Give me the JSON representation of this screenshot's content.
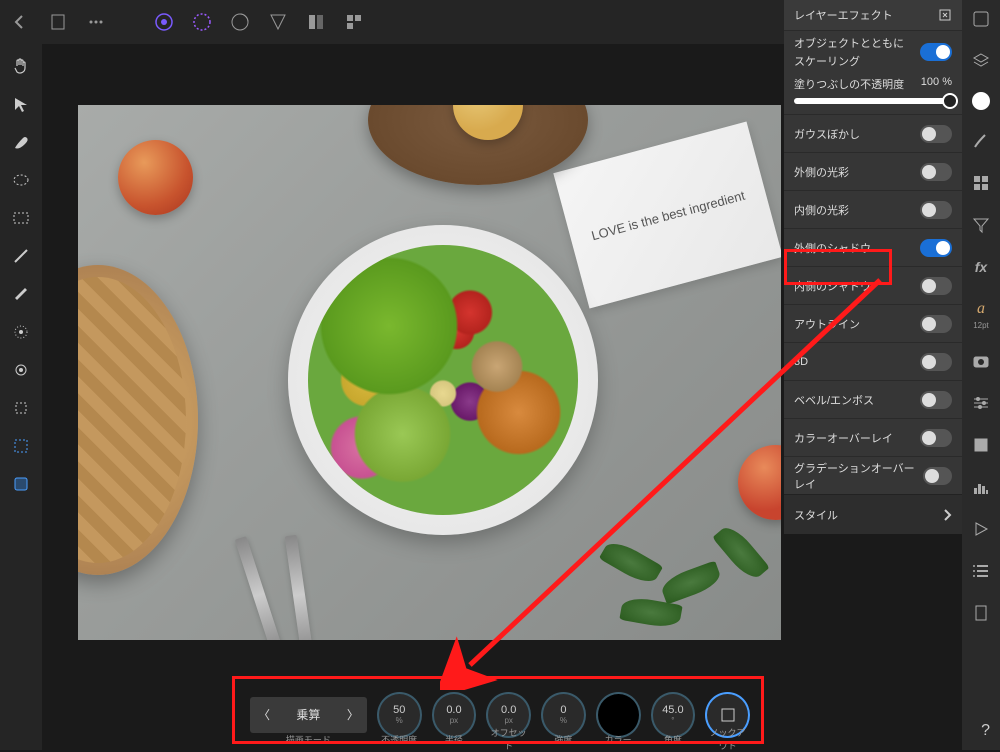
{
  "panel": {
    "title": "レイヤーエフェクト",
    "scale_label_1": "オブジェクトとともに",
    "scale_label_2": "スケーリング",
    "scale_on": true,
    "fill_opacity_label": "塗りつぶしの不透明度",
    "fill_opacity_value": "100 %",
    "effects": [
      {
        "name": "ガウスぼかし",
        "on": false,
        "highlighted": false
      },
      {
        "name": "外側の光彩",
        "on": false,
        "highlighted": false
      },
      {
        "name": "内側の光彩",
        "on": false,
        "highlighted": false
      },
      {
        "name": "外側のシャドウ",
        "on": true,
        "highlighted": true
      },
      {
        "name": "内側のシャドウ",
        "on": false,
        "highlighted": false
      },
      {
        "name": "アウトライン",
        "on": false,
        "highlighted": false
      },
      {
        "name": "3D",
        "on": false,
        "highlighted": false
      },
      {
        "name": "ベベル/エンボス",
        "on": false,
        "highlighted": false
      },
      {
        "name": "カラーオーバーレイ",
        "on": false,
        "highlighted": false
      },
      {
        "name": "グラデーションオーバーレイ",
        "on": false,
        "highlighted": false
      }
    ],
    "style_label": "スタイル"
  },
  "bottom": {
    "blend_mode": "乗算",
    "blend_label": "描画モード",
    "controls": [
      {
        "value": "50",
        "unit": "%",
        "label": "不透明度"
      },
      {
        "value": "0.0",
        "unit": "px",
        "label": "半径"
      },
      {
        "value": "0.0",
        "unit": "px",
        "label": "オフセット"
      },
      {
        "value": "0",
        "unit": "%",
        "label": "強度"
      },
      {
        "value": "",
        "unit": "",
        "label": "カラー",
        "is_color": true
      },
      {
        "value": "45.0",
        "unit": "°",
        "label": "角度"
      },
      {
        "value": "",
        "unit": "",
        "label": "ノックアウト",
        "is_knockout": true
      }
    ]
  },
  "napkin_text": "LOVE is the best ingredient",
  "right_studio": {
    "fx_label": "fx",
    "a_label": "a",
    "pt_label": "12pt"
  },
  "help": "?"
}
